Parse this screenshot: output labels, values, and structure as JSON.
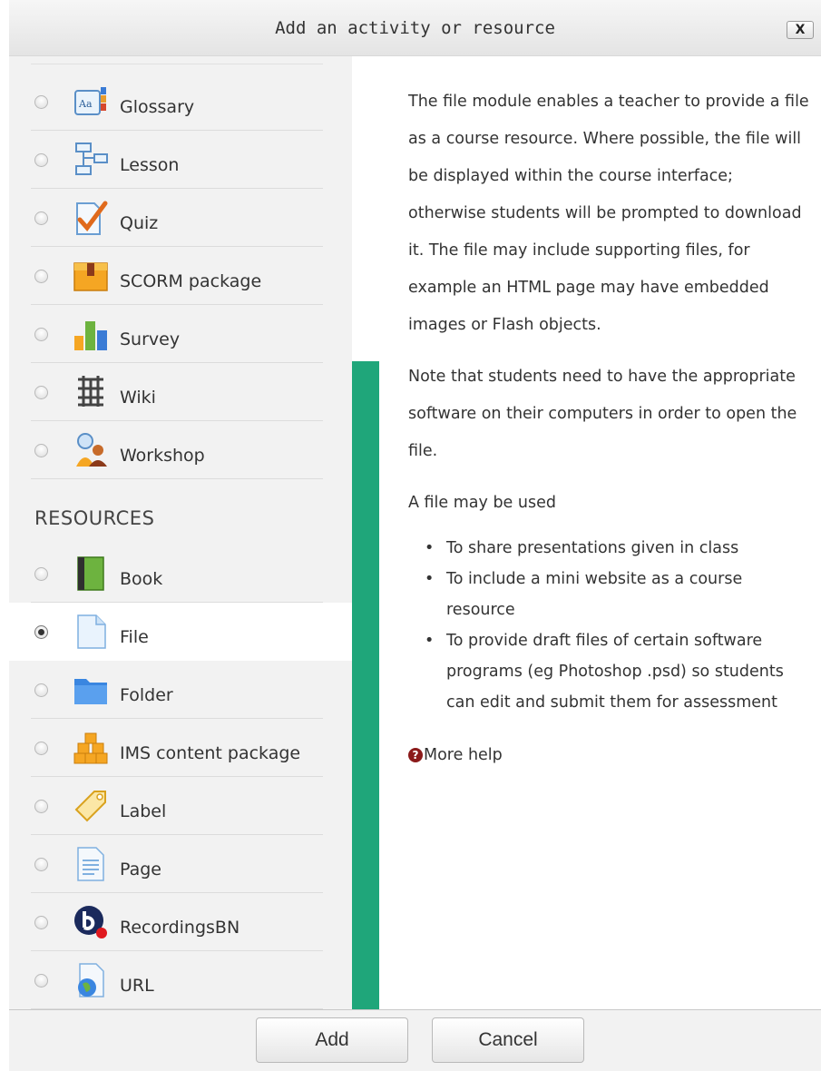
{
  "dialog": {
    "title": "Add an activity or resource",
    "close_label": "X"
  },
  "activities": [
    {
      "label": "Glossary",
      "icon": "glossary-icon"
    },
    {
      "label": "Lesson",
      "icon": "lesson-icon"
    },
    {
      "label": "Quiz",
      "icon": "quiz-icon"
    },
    {
      "label": "SCORM package",
      "icon": "scorm-package-icon"
    },
    {
      "label": "Survey",
      "icon": "survey-icon"
    },
    {
      "label": "Wiki",
      "icon": "wiki-icon"
    },
    {
      "label": "Workshop",
      "icon": "workshop-icon"
    }
  ],
  "resources_heading": "RESOURCES",
  "resources": [
    {
      "label": "Book",
      "icon": "book-icon",
      "selected": false
    },
    {
      "label": "File",
      "icon": "file-icon",
      "selected": true
    },
    {
      "label": "Folder",
      "icon": "folder-icon",
      "selected": false
    },
    {
      "label": "IMS content package",
      "icon": "ims-content-package-icon",
      "selected": false
    },
    {
      "label": "Label",
      "icon": "label-icon",
      "selected": false
    },
    {
      "label": "Page",
      "icon": "page-icon",
      "selected": false
    },
    {
      "label": "RecordingsBN",
      "icon": "recordingsbn-icon",
      "selected": false
    },
    {
      "label": "URL",
      "icon": "url-icon",
      "selected": false
    }
  ],
  "help": {
    "paragraph1": "The file module enables a teacher to provide a file as a course resource. Where possible, the file will be displayed within the course interface; otherwise students will be prompted to download it. The file may include supporting files, for example an HTML page may have embedded images or Flash objects.",
    "paragraph2": "Note that students need to have the appropriate software on their computers in order to open the file.",
    "paragraph3": "A file may be used",
    "bullets": [
      "To share presentations given in class",
      "To include a mini website as a course resource",
      "To provide draft files of certain software programs (eg Photoshop .psd) so students can edit and submit them for assessment"
    ],
    "more_help": "More help"
  },
  "footer": {
    "add_label": "Add",
    "cancel_label": "Cancel"
  },
  "colors": {
    "accent_bar": "#1fa67a",
    "options_bg": "#f2f2f2",
    "help_icon": "#8b1a1a"
  }
}
